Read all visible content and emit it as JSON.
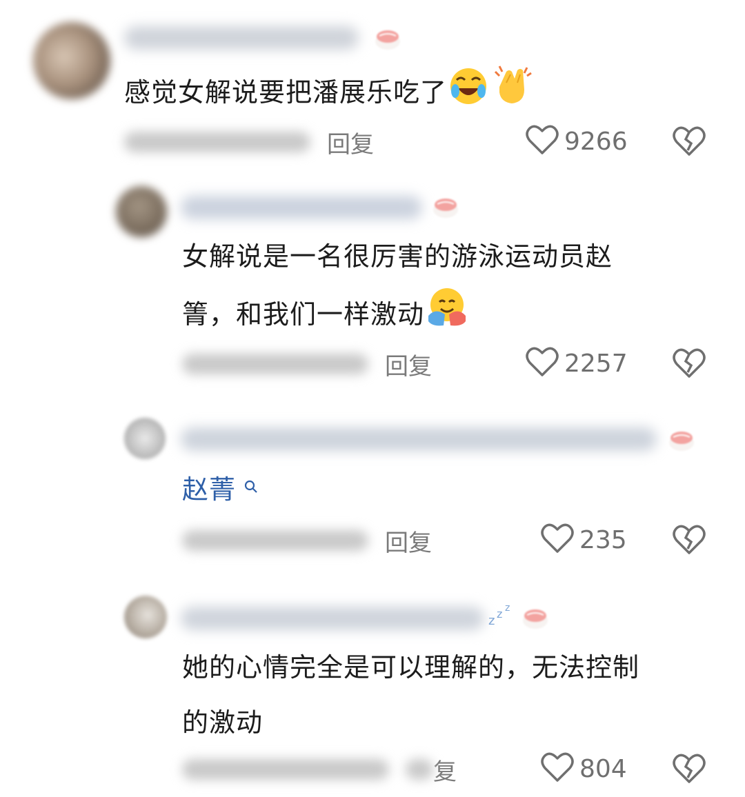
{
  "comments": [
    {
      "text": "感觉女解说要把潘展乐吃了",
      "emoji": [
        "rolling-laughing-face",
        "clapping-hands"
      ],
      "reply_label": "回复",
      "likes": "9266"
    },
    {
      "text_line1": "女解说是一名很厉害的游泳运动员赵",
      "text_line2": "箐，和我们一样激动",
      "emoji": [
        "hugging-face"
      ],
      "reply_label": "回复",
      "likes": "2257"
    },
    {
      "link_text": "赵菁",
      "reply_label": "回复",
      "likes": "235"
    },
    {
      "text_line1": "她的心情完全是可以理解的，无法控制",
      "text_line2": "的激动",
      "reply_label": "复",
      "likes": "804"
    }
  ],
  "colors": {
    "link": "#2e5fa8",
    "meta": "#7a7a7a",
    "icon": "#6f6f6f"
  }
}
